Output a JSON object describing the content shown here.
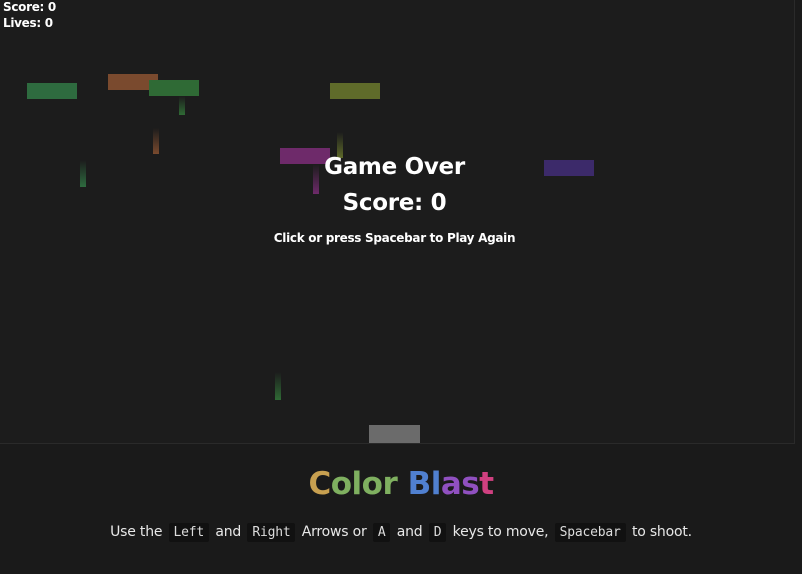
{
  "hud": {
    "score_text": "Score: 0",
    "lives_text": "Lives: 0"
  },
  "game_over": {
    "title": "Game Over",
    "score_text": "Score: 0",
    "hint": "Click or press Spacebar to Play Again"
  },
  "footer": {
    "title_part1": "Color",
    "title_part2": "Blast",
    "instructions": {
      "t1": "Use the",
      "k1": "Left",
      "t2": "and",
      "k2": "Right",
      "t3": "Arrows or",
      "k3": "A",
      "t4": "and",
      "k4": "D",
      "t5": "keys to move,",
      "k5": "Spacebar",
      "t6": "to shoot."
    }
  },
  "colors": {
    "background": "#1a1a1a",
    "canvas": "#1c1c1c",
    "player": "#6b6b6b",
    "block_green_dark": "#2e6b3f",
    "block_orange": "#7a4a2e",
    "block_green": "#2f6a35",
    "block_olive": "#5f6b2a",
    "block_magenta": "#6e2a6a",
    "block_indigo": "#3c2a6a",
    "title_gradient": [
      "#c8a050",
      "#7fb060",
      "#5080d0",
      "#9050c0",
      "#d04080"
    ]
  }
}
